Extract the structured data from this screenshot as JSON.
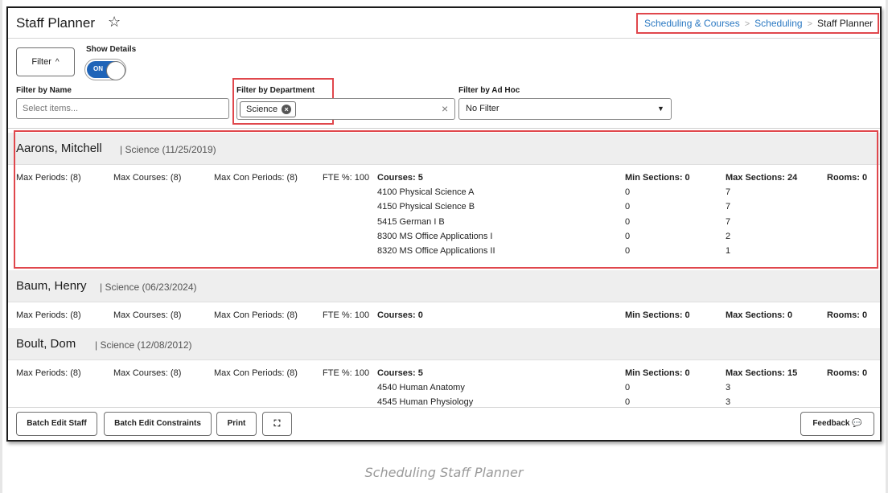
{
  "header": {
    "title": "Staff Planner",
    "breadcrumb": [
      "Scheduling & Courses",
      "Scheduling",
      "Staff Planner"
    ]
  },
  "filters": {
    "filter_button": "Filter",
    "show_details_label": "Show Details",
    "toggle_state": "ON",
    "by_name": {
      "label": "Filter by Name",
      "placeholder": "Select items..."
    },
    "by_department": {
      "label": "Filter by Department",
      "chip": "Science"
    },
    "by_adhoc": {
      "label": "Filter by Ad Hoc",
      "value": "No Filter"
    }
  },
  "staff": [
    {
      "name": "Aarons, Mitchell",
      "meta": "| Science (11/25/2019)",
      "max_periods": "Max Periods: (8)",
      "max_courses": "Max Courses: (8)",
      "max_con_periods": "Max Con Periods: (8)",
      "fte": "FTE %: 100",
      "courses_label": "Courses: 5",
      "min_sections": "Min Sections: 0",
      "max_sections": "Max Sections: 24",
      "rooms": "Rooms: 0",
      "courses": [
        {
          "name": "4100 Physical Science A",
          "min": "0",
          "max": "7"
        },
        {
          "name": "4150 Physical Science B",
          "min": "0",
          "max": "7"
        },
        {
          "name": "5415 German I B",
          "min": "0",
          "max": "7"
        },
        {
          "name": "8300 MS Office Applications I",
          "min": "0",
          "max": "2"
        },
        {
          "name": "8320 MS Office Applications II",
          "min": "0",
          "max": "1"
        }
      ]
    },
    {
      "name": "Baum, Henry",
      "meta": "| Science (06/23/2024)",
      "max_periods": "Max Periods: (8)",
      "max_courses": "Max Courses: (8)",
      "max_con_periods": "Max Con Periods: (8)",
      "fte": "FTE %: 100",
      "courses_label": "Courses: 0",
      "min_sections": "Min Sections: 0",
      "max_sections": "Max Sections: 0",
      "rooms": "Rooms: 0",
      "courses": []
    },
    {
      "name": "Boult, Dom",
      "meta": "| Science (12/08/2012)",
      "max_periods": "Max Periods: (8)",
      "max_courses": "Max Courses: (8)",
      "max_con_periods": "Max Con Periods: (8)",
      "fte": "FTE %: 100",
      "courses_label": "Courses: 5",
      "min_sections": "Min Sections: 0",
      "max_sections": "Max Sections: 15",
      "rooms": "Rooms: 0",
      "courses": [
        {
          "name": "4540 Human Anatomy",
          "min": "0",
          "max": "3"
        },
        {
          "name": "4545 Human Physiology",
          "min": "0",
          "max": "3"
        }
      ]
    }
  ],
  "footer": {
    "batch_edit_staff": "Batch Edit Staff",
    "batch_edit_constraints": "Batch Edit Constraints",
    "print": "Print",
    "feedback": "Feedback"
  },
  "caption": "Scheduling Staff Planner",
  "colors": {
    "accent": "#1f64b8",
    "highlight": "#e0474c",
    "link": "#2a78c2"
  },
  "icons": {
    "favorite": "star-icon",
    "expand": "expand-icon",
    "feedback": "speech-bubble-icon"
  }
}
